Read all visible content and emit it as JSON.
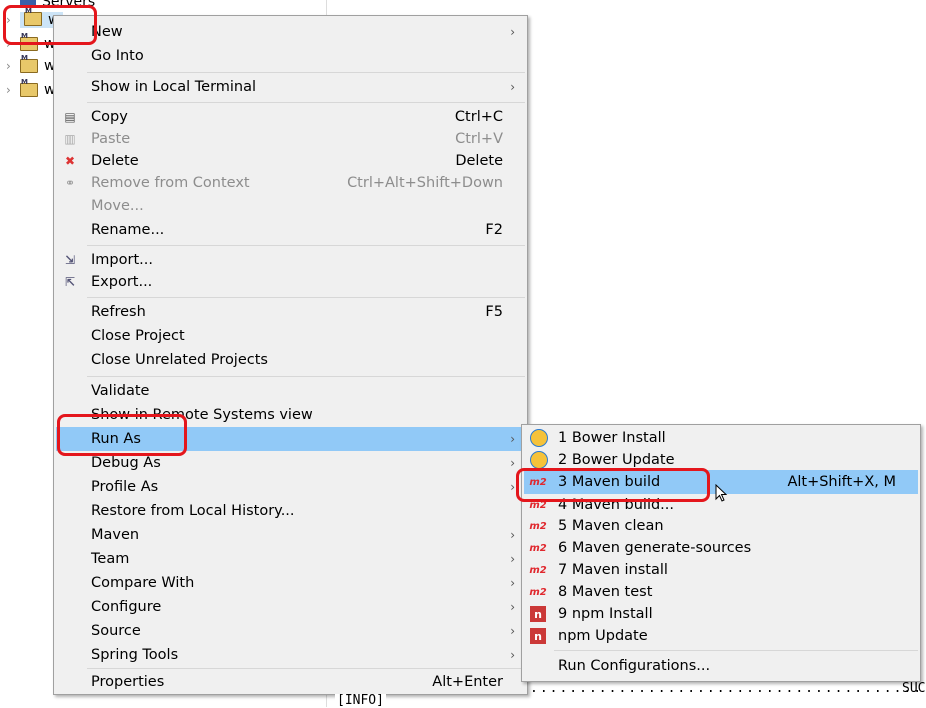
{
  "tree": {
    "items": [
      {
        "label": "Servers"
      },
      {
        "label": "w"
      },
      {
        "label": "w"
      },
      {
        "label": "w"
      },
      {
        "label": "w"
      }
    ]
  },
  "context_menu": {
    "items": [
      {
        "label": "New",
        "arrow": true
      },
      {
        "label": "Go Into"
      },
      {
        "sep": true
      },
      {
        "label": "Show in Local Terminal",
        "arrow": true
      },
      {
        "sep": true
      },
      {
        "label": "Copy",
        "shortcut": "Ctrl+C",
        "icon": "copy-icon"
      },
      {
        "label": "Paste",
        "shortcut": "Ctrl+V",
        "icon": "paste-icon",
        "disabled": true
      },
      {
        "label": "Delete",
        "shortcut": "Delete",
        "icon": "delete-icon"
      },
      {
        "label": "Remove from Context",
        "shortcut": "Ctrl+Alt+Shift+Down",
        "icon": "remove-context-icon",
        "disabled": true
      },
      {
        "label": "Move...",
        "disabled": true
      },
      {
        "label": "Rename...",
        "shortcut": "F2"
      },
      {
        "sep": true
      },
      {
        "label": "Import...",
        "icon": "import-icon"
      },
      {
        "label": "Export...",
        "icon": "export-icon"
      },
      {
        "sep": true
      },
      {
        "label": "Refresh",
        "shortcut": "F5"
      },
      {
        "label": "Close Project"
      },
      {
        "label": "Close Unrelated Projects"
      },
      {
        "sep": true
      },
      {
        "label": "Validate"
      },
      {
        "label": "Show in Remote Systems view"
      },
      {
        "label": "Run As",
        "arrow": true,
        "highlighted": true
      },
      {
        "label": "Debug As",
        "arrow": true
      },
      {
        "label": "Profile As",
        "arrow": true
      },
      {
        "label": "Restore from Local History..."
      },
      {
        "label": "Maven",
        "arrow": true
      },
      {
        "label": "Team",
        "arrow": true
      },
      {
        "label": "Compare With",
        "arrow": true
      },
      {
        "label": "Configure",
        "arrow": true
      },
      {
        "label": "Source",
        "arrow": true
      },
      {
        "label": "Spring Tools",
        "arrow": true
      },
      {
        "sep": true
      },
      {
        "label": "Properties",
        "shortcut": "Alt+Enter"
      }
    ]
  },
  "run_as_menu": {
    "items": [
      {
        "label": "1 Bower Install",
        "icon": "bower-icon"
      },
      {
        "label": "2 Bower Update",
        "icon": "bower-icon"
      },
      {
        "label": "3 Maven build",
        "shortcut": "Alt+Shift+X, M",
        "icon": "maven-icon",
        "highlighted": true
      },
      {
        "label": "4 Maven build...",
        "icon": "maven-icon"
      },
      {
        "label": "5 Maven clean",
        "icon": "maven-icon"
      },
      {
        "label": "6 Maven generate-sources",
        "icon": "maven-icon"
      },
      {
        "label": "7 Maven install",
        "icon": "maven-icon"
      },
      {
        "label": "8 Maven test",
        "icon": "maven-icon"
      },
      {
        "label": "9 npm Install",
        "icon": "npm-icon"
      },
      {
        "label": "npm Update",
        "icon": "npm-icon"
      },
      {
        "sep": true
      },
      {
        "label": "Run Configurations..."
      }
    ]
  },
  "console": {
    "line1": "[INFO]",
    "line2": "SUC",
    "dots": "........................................"
  },
  "colors": {
    "highlight": "#91c9f7",
    "annotation": "#e4161c",
    "menu_bg": "#f0f0f0"
  }
}
